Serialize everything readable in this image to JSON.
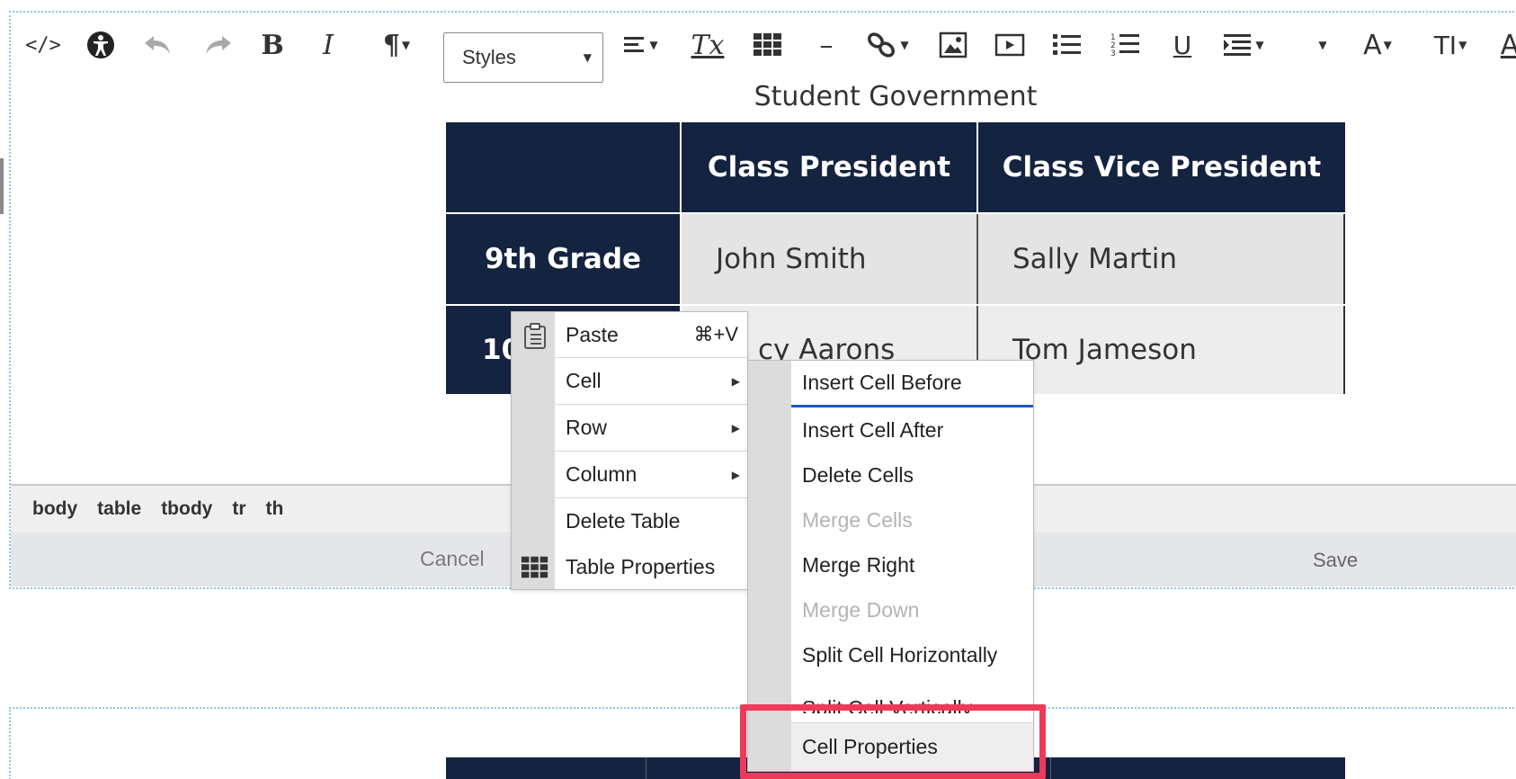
{
  "toolbar": {
    "styles_label": "Styles",
    "buttons": [
      {
        "name": "source-code-button",
        "glyph": "</>"
      },
      {
        "name": "accessibility-button",
        "glyph": "♿"
      },
      {
        "name": "undo-button",
        "glyph": "↶"
      },
      {
        "name": "redo-button",
        "glyph": "↷"
      },
      {
        "name": "bold-button",
        "glyph": "B"
      },
      {
        "name": "italic-button",
        "glyph": "I"
      },
      {
        "name": "paragraph-button",
        "glyph": "¶"
      },
      {
        "name": "align-button",
        "glyph": "≡"
      },
      {
        "name": "clear-format-button",
        "glyph": "Tx"
      },
      {
        "name": "table-button",
        "glyph": "▦"
      },
      {
        "name": "horizontal-rule-button",
        "glyph": "–"
      },
      {
        "name": "link-button",
        "glyph": "🔗"
      },
      {
        "name": "image-button",
        "glyph": "▣"
      },
      {
        "name": "media-button",
        "glyph": "▶"
      },
      {
        "name": "bullet-list-button",
        "glyph": "☰"
      },
      {
        "name": "numbered-list-button",
        "glyph": "☷"
      },
      {
        "name": "underline-button",
        "glyph": "U"
      },
      {
        "name": "indent-button",
        "glyph": "⇥"
      },
      {
        "name": "font-size-button",
        "glyph": "A"
      },
      {
        "name": "line-height-button",
        "glyph": "TI"
      },
      {
        "name": "font-color-button",
        "glyph": "A"
      }
    ]
  },
  "table": {
    "caption": "Student Government",
    "headers": [
      "",
      "Class President",
      "Class Vice President"
    ],
    "rows": [
      {
        "label": "9th Grade",
        "president": "John Smith",
        "vice_president": "Sally Martin"
      },
      {
        "label": "10",
        "president": "cy Aarons",
        "vice_president": "Tom Jameson"
      }
    ]
  },
  "path": [
    "body",
    "table",
    "tbody",
    "tr",
    "th"
  ],
  "footer": {
    "cancel": "Cancel",
    "save": "Save"
  },
  "context_menu": {
    "items": [
      {
        "label": "Paste",
        "shortcut": "⌘+V"
      },
      {
        "label": "Cell"
      },
      {
        "label": "Row"
      },
      {
        "label": "Column"
      },
      {
        "label": "Delete Table"
      },
      {
        "label": "Table Properties"
      }
    ]
  },
  "cell_submenu": {
    "items": [
      {
        "label": "Insert Cell Before",
        "disabled": false
      },
      {
        "label": "Insert Cell After",
        "disabled": false
      },
      {
        "label": "Delete Cells",
        "disabled": false
      },
      {
        "label": "Merge Cells",
        "disabled": true
      },
      {
        "label": "Merge Right",
        "disabled": false
      },
      {
        "label": "Merge Down",
        "disabled": true
      },
      {
        "label": "Split Cell Horizontally",
        "disabled": false
      },
      {
        "label": "Split Cell Vertically",
        "disabled": false
      },
      {
        "label": "Cell Properties",
        "disabled": false
      }
    ]
  },
  "colors": {
    "table_header": "#14233f",
    "highlight": "#ee3a58",
    "frame": "#8fc3e3"
  }
}
